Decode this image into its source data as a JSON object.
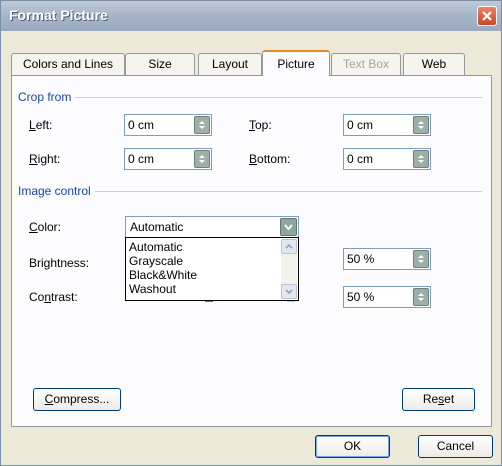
{
  "window": {
    "title": "Format Picture"
  },
  "tabs": [
    {
      "label": "Colors and Lines"
    },
    {
      "label": "Size"
    },
    {
      "label": "Layout"
    },
    {
      "label": "Picture"
    },
    {
      "label": "Text Box"
    },
    {
      "label": "Web"
    }
  ],
  "active_tab": "Picture",
  "crop": {
    "group_label": "Crop from",
    "left_label": "Left:",
    "left_value": "0 cm",
    "right_label": "Right:",
    "right_value": "0 cm",
    "top_label": "Top:",
    "top_value": "0 cm",
    "bottom_label": "Bottom:",
    "bottom_value": "0 cm"
  },
  "image_control": {
    "group_label": "Image control",
    "color_label": "Color:",
    "color_value": "Automatic",
    "color_options": [
      "Automatic",
      "Grayscale",
      "Black&White",
      "Washout"
    ],
    "brightness_label": "Brightness:",
    "brightness_value": "50 %",
    "contrast_label": "Contrast:",
    "contrast_value": "50 %"
  },
  "buttons": {
    "compress": "Compress...",
    "reset": "Reset",
    "ok": "OK",
    "cancel": "Cancel"
  },
  "colors": {
    "dialog_bg": "#ECE9D8",
    "group_label": "#1A45A6",
    "active_tab_accent": "#E68B2C"
  },
  "icons": [
    "close-icon",
    "spin-up-icon",
    "spin-down-icon",
    "chevron-down-icon",
    "scroll-up-icon",
    "scroll-down-icon"
  ]
}
